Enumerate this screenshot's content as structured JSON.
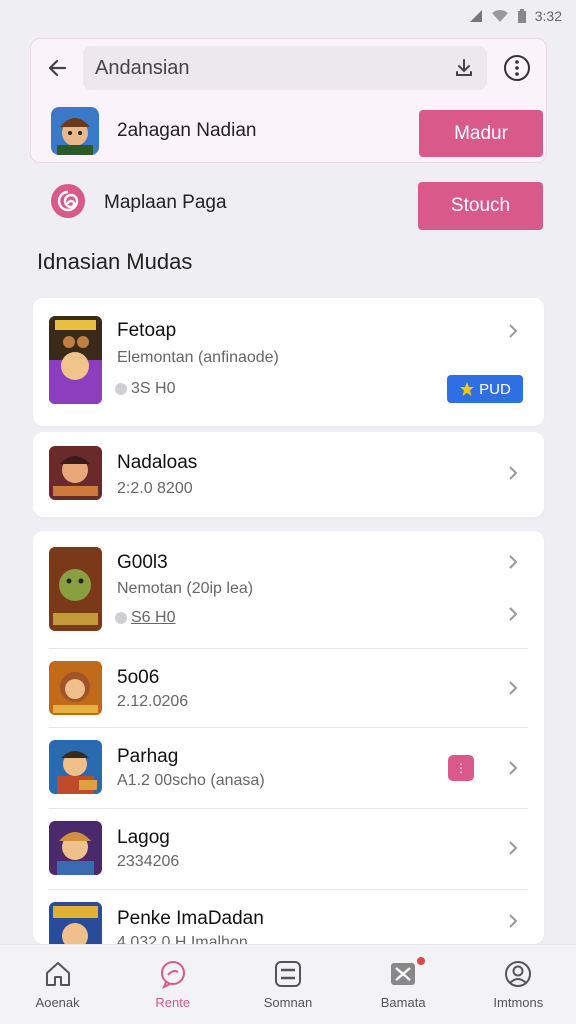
{
  "status_bar": {
    "time": "3:32"
  },
  "header": {
    "search_value": "Andansian",
    "app_row": {
      "label": "2ahagan Nadian",
      "button": "Madur"
    }
  },
  "page_row": {
    "label": "Maplaan Paga",
    "button": "Stouch"
  },
  "section_title": "Idnasian Mudas",
  "cards": [
    {
      "items": [
        {
          "title": "Fetoap",
          "subtitle": "Elemontan (anfinaode)",
          "meta": "3S H0",
          "badge": "PUD",
          "colors": [
            "#3a2a1a",
            "#8b3fbf"
          ]
        }
      ]
    },
    {
      "items": [
        {
          "title": "Nadaloas",
          "subtitle": "2:2.0 8200",
          "colors": [
            "#6b2a2a",
            "#d07a3a"
          ]
        }
      ]
    },
    {
      "items": [
        {
          "title": "G00l3",
          "subtitle": "Nemotan (20ip lea)",
          "meta": "S6 H0",
          "colors": [
            "#7a3a1a",
            "#c29a3a"
          ]
        },
        {
          "title": "5o06",
          "subtitle": "2.12.0206",
          "colors": [
            "#c06a1a",
            "#e8b040"
          ]
        },
        {
          "title": "Parhag",
          "subtitle": "A1.2 00scho (anasa)",
          "colors": [
            "#2a6ab0",
            "#e0a040"
          ]
        },
        {
          "title": "Lagog",
          "subtitle": "2334206",
          "colors": [
            "#4a2a6a",
            "#d09040"
          ]
        },
        {
          "title": "Penke ImaDadan",
          "subtitle": "4.032 0 H Imalhon",
          "colors": [
            "#2a4a9a",
            "#e0b030"
          ]
        }
      ]
    }
  ],
  "bottom_nav": [
    {
      "label": "Aoenak",
      "icon": "home-icon"
    },
    {
      "label": "Rente",
      "icon": "chat-icon",
      "active": true
    },
    {
      "label": "Somnan",
      "icon": "grid-icon"
    },
    {
      "label": "Bamata",
      "icon": "game-icon"
    },
    {
      "label": "Imtmons",
      "icon": "profile-icon"
    }
  ],
  "colors": {
    "accent": "#d9598a",
    "badge": "#2f6fe4",
    "background": "#eeeef3"
  }
}
